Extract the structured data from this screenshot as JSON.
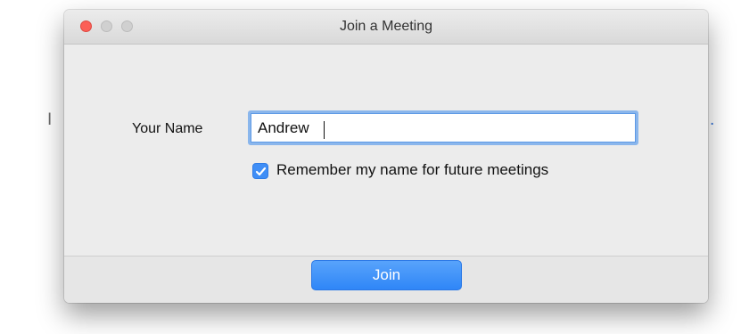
{
  "background": {
    "text_left": "I",
    "text_right": "."
  },
  "dialog": {
    "title": "Join a Meeting",
    "window_controls": {
      "close": "close-window",
      "minimize": "minimize-window",
      "zoom": "zoom-window"
    },
    "name_label": "Your Name",
    "name_value": "Andrew",
    "remember_checked": true,
    "remember_label": "Remember my name for future meetings",
    "join_label": "Join"
  },
  "colors": {
    "accent": "#3f8ef6",
    "button_top": "#58a3fb",
    "button_bottom": "#2f86f7",
    "close_button": "#fc5f57",
    "dialog_bg": "#ececec",
    "field_focus_ring": "#8ab6ec"
  },
  "icons": {
    "checkbox": "checkmark-icon"
  }
}
